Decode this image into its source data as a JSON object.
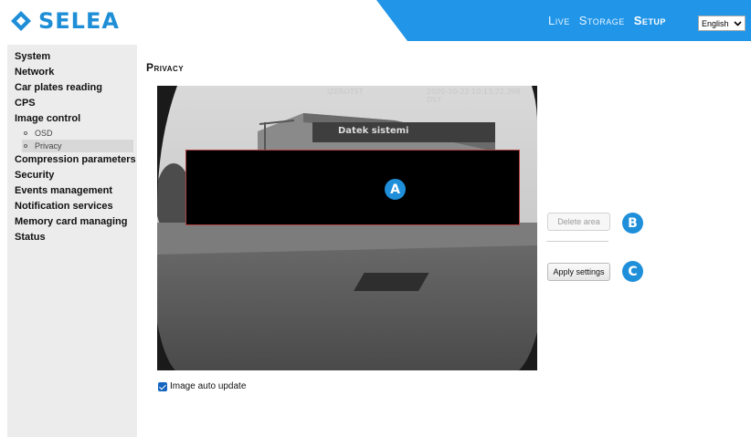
{
  "brand": {
    "name": "SELEA",
    "color": "#1e8ed6"
  },
  "nav": {
    "items": [
      {
        "label": "Live",
        "active": false
      },
      {
        "label": "Storage",
        "active": false
      },
      {
        "label": "Setup",
        "active": true
      }
    ],
    "language": "English",
    "accent": "#2196e8"
  },
  "sidebar": {
    "items": [
      {
        "label": "System"
      },
      {
        "label": "Network"
      },
      {
        "label": "Car plates reading"
      },
      {
        "label": "CPS"
      },
      {
        "label": "Image control"
      },
      {
        "label": "Compression parameters"
      },
      {
        "label": "Security"
      },
      {
        "label": "Events management"
      },
      {
        "label": "Notification services"
      },
      {
        "label": "Memory card managing"
      },
      {
        "label": "Status"
      }
    ],
    "subitems": [
      {
        "label": "OSD",
        "selected": false
      },
      {
        "label": "Privacy",
        "selected": true
      }
    ]
  },
  "main": {
    "title": "Privacy",
    "camera": {
      "name": "IZEROTST",
      "timestamp": "2020-10-22 10:13:22.398 DST",
      "sign_text": "Datek sistemi"
    },
    "markers": [
      "A",
      "B",
      "C"
    ],
    "buttons": {
      "delete_area": "Delete area",
      "apply_settings": "Apply settings"
    },
    "auto_update": {
      "label": "Image auto update",
      "checked": true
    }
  }
}
